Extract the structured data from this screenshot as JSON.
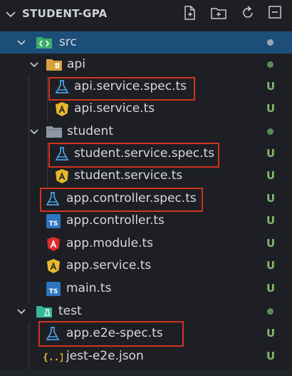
{
  "explorer": {
    "title": "STUDENT-GPA",
    "actions": [
      "new-file-icon",
      "new-folder-icon",
      "refresh-icon",
      "collapse-all-icon"
    ]
  },
  "tree": [
    {
      "label": "src",
      "type": "folder-src",
      "depth": 0,
      "expanded": true,
      "selected": true,
      "status": "dot-light"
    },
    {
      "label": "api",
      "type": "folder-api",
      "depth": 1,
      "expanded": true,
      "status": "dot"
    },
    {
      "label": "api.service.spec.ts",
      "type": "test-file",
      "depth": 2,
      "status": "U",
      "highlighted": true
    },
    {
      "label": "api.service.ts",
      "type": "angular-service",
      "depth": 2,
      "status": "U"
    },
    {
      "label": "student",
      "type": "folder",
      "depth": 1,
      "expanded": true,
      "status": "dot"
    },
    {
      "label": "student.service.spec.ts",
      "type": "test-file",
      "depth": 2,
      "status": "U",
      "highlighted": true
    },
    {
      "label": "student.service.ts",
      "type": "angular-service",
      "depth": 2,
      "status": "U"
    },
    {
      "label": "app.controller.spec.ts",
      "type": "test-file",
      "depth": 1,
      "status": "U",
      "highlighted": true
    },
    {
      "label": "app.controller.ts",
      "type": "typescript",
      "depth": 1,
      "status": "U"
    },
    {
      "label": "app.module.ts",
      "type": "angular-module",
      "depth": 1,
      "status": "U"
    },
    {
      "label": "app.service.ts",
      "type": "angular-service",
      "depth": 1,
      "status": "U"
    },
    {
      "label": "main.ts",
      "type": "typescript",
      "depth": 1,
      "status": "U"
    },
    {
      "label": "test",
      "type": "folder-test",
      "depth": 0,
      "expanded": true,
      "status": "dot"
    },
    {
      "label": "app.e2e-spec.ts",
      "type": "test-file",
      "depth": 1,
      "status": "U",
      "highlighted": true
    },
    {
      "label": "jest-e2e.json",
      "type": "json",
      "depth": 1,
      "status": "U"
    }
  ],
  "colors": {
    "background": "#1e1f25",
    "selection": "#1c4e79",
    "untracked": "#7fb76e",
    "highlight_box": "#d0341f"
  }
}
